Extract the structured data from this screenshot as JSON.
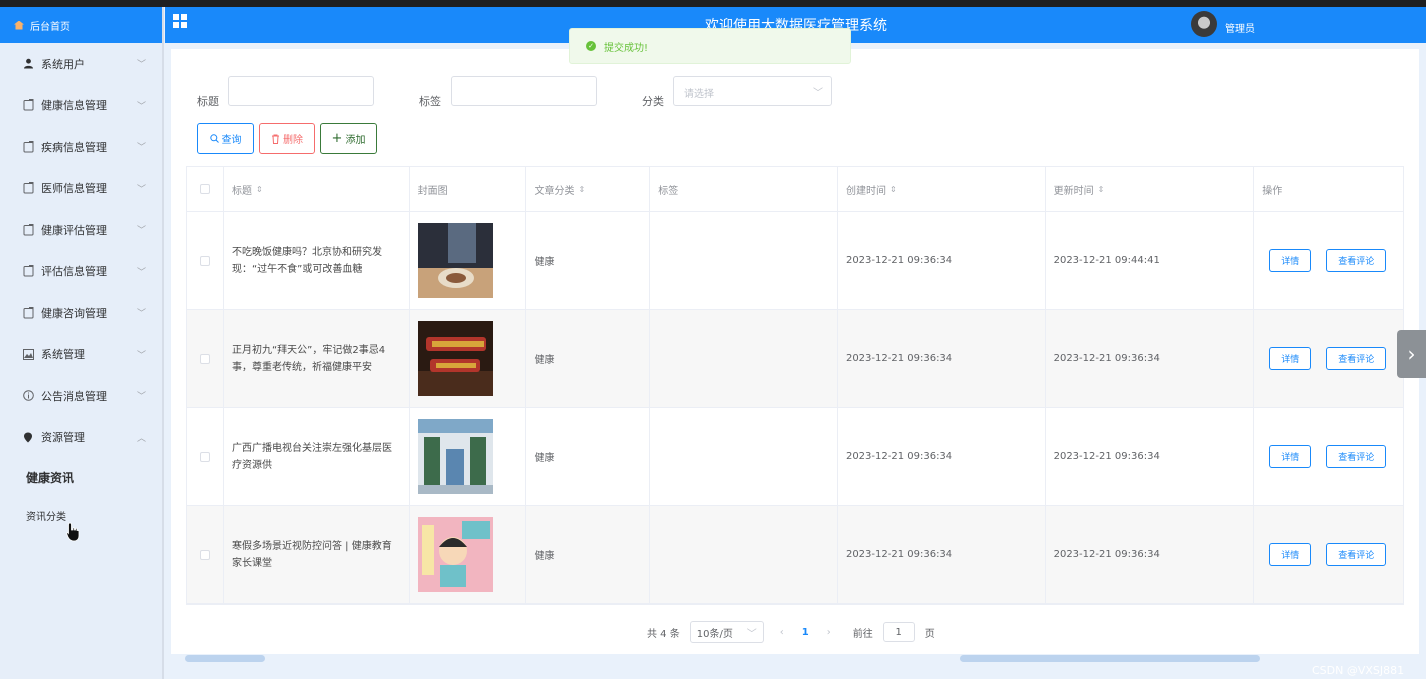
{
  "sidebar": {
    "home_label": "后台首页",
    "items": [
      {
        "label": "系统用户",
        "icon": "user-icon"
      },
      {
        "label": "健康信息管理",
        "icon": "document-icon"
      },
      {
        "label": "疾病信息管理",
        "icon": "document-icon"
      },
      {
        "label": "医师信息管理",
        "icon": "document-icon"
      },
      {
        "label": "健康评估管理",
        "icon": "document-icon"
      },
      {
        "label": "评估信息管理",
        "icon": "document-icon"
      },
      {
        "label": "健康咨询管理",
        "icon": "document-icon"
      },
      {
        "label": "系统管理",
        "icon": "picture-icon"
      },
      {
        "label": "公告消息管理",
        "icon": "info-icon"
      },
      {
        "label": "资源管理",
        "icon": "location-icon"
      }
    ],
    "sub_items": [
      {
        "label": "健康资讯",
        "active": true
      },
      {
        "label": "资讯分类",
        "active": false
      }
    ]
  },
  "header": {
    "title": "欢迎使用大数据医疗管理系统",
    "user_name": "管理员"
  },
  "toast": {
    "message": "提交成功!"
  },
  "filters": {
    "title_label": "标题",
    "tag_label": "标签",
    "category_label": "分类",
    "category_placeholder": "请选择"
  },
  "buttons": {
    "search": "查询",
    "delete": "删除",
    "add": "添加"
  },
  "table": {
    "columns": [
      "标题",
      "封面图",
      "文章分类",
      "标签",
      "创建时间",
      "更新时间",
      "操作"
    ],
    "rows": [
      {
        "title": "不吃晚饭健康吗？北京协和研究发现：“过午不食”或可改善血糖",
        "category": "健康",
        "tag": "",
        "created": "2023-12-21 09:36:34",
        "updated": "2023-12-21 09:44:41",
        "cover_colors": [
          "#2b2f3a",
          "#c8a27a",
          "#8a5a3b"
        ]
      },
      {
        "title": "正月初九“拜天公”，牢记做2事忌4事，尊重老传统，祈福健康平安",
        "category": "健康",
        "tag": "",
        "created": "2023-12-21 09:36:34",
        "updated": "2023-12-21 09:36:34",
        "cover_colors": [
          "#2a1a12",
          "#d8a53a",
          "#b2352b"
        ]
      },
      {
        "title": "广西广播电视台关注崇左强化基层医疗资源供",
        "category": "健康",
        "tag": "",
        "created": "2023-12-21 09:36:34",
        "updated": "2023-12-21 09:36:34",
        "cover_colors": [
          "#7fa8c8",
          "#dfe6ec",
          "#3d6b4b"
        ]
      },
      {
        "title": "寒假多场景近视防控问答 | 健康教育家长课堂",
        "category": "健康",
        "tag": "",
        "created": "2023-12-21 09:36:34",
        "updated": "2023-12-21 09:36:34",
        "cover_colors": [
          "#f2b5c0",
          "#6fc1c9",
          "#f7e6a6"
        ]
      }
    ],
    "detail_label": "详情",
    "comments_label": "查看评论"
  },
  "pagination": {
    "total": "共 4 条",
    "page_size": "10条/页",
    "current_page": "1",
    "goto_label": "前往",
    "goto_value": "1",
    "page_suffix": "页"
  },
  "watermark": "CSDN @VXSJ881"
}
